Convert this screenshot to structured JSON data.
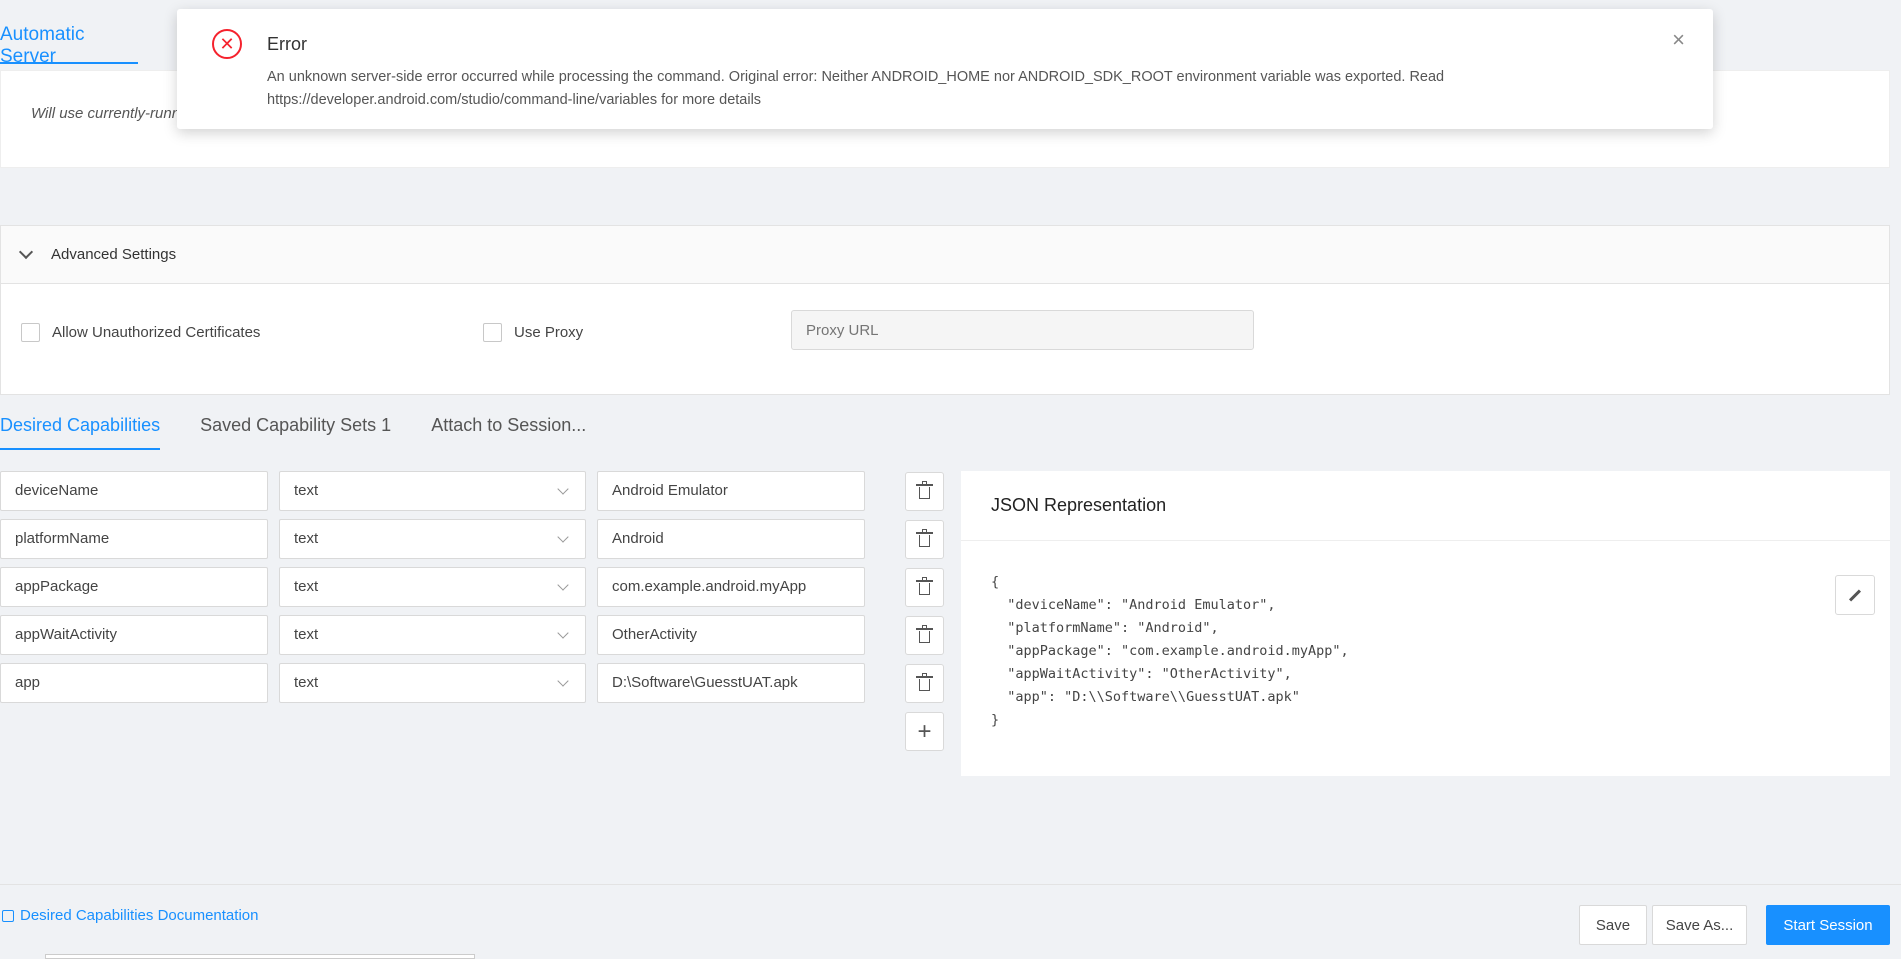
{
  "server": {
    "tab_label": "Automatic Server",
    "note": "Will use currently-running"
  },
  "advanced": {
    "title": "Advanced Settings",
    "allow_unauthorized": "Allow Unauthorized Certificates",
    "use_proxy": "Use Proxy",
    "proxy_placeholder": "Proxy URL"
  },
  "tabs": [
    {
      "label": "Desired Capabilities"
    },
    {
      "label": "Saved Capability Sets 1"
    },
    {
      "label": "Attach to Session..."
    }
  ],
  "capabilities": [
    {
      "name": "deviceName",
      "type": "text",
      "value": "Android Emulator"
    },
    {
      "name": "platformName",
      "type": "text",
      "value": "Android"
    },
    {
      "name": "appPackage",
      "type": "text",
      "value": "com.example.android.myApp"
    },
    {
      "name": "appWaitActivity",
      "type": "text",
      "value": "OtherActivity"
    },
    {
      "name": "app",
      "type": "text",
      "value": "D:\\Software\\GuesstUAT.apk"
    }
  ],
  "json_panel": {
    "title": "JSON Representation",
    "code": "{\n  \"deviceName\": \"Android Emulator\",\n  \"platformName\": \"Android\",\n  \"appPackage\": \"com.example.android.myApp\",\n  \"appWaitActivity\": \"OtherActivity\",\n  \"app\": \"D:\\\\Software\\\\GuesstUAT.apk\"\n}"
  },
  "footer": {
    "doc_link": "Desired Capabilities Documentation",
    "save": "Save",
    "save_as": "Save As...",
    "start": "Start Session"
  },
  "notification": {
    "title": "Error",
    "message": "An unknown server-side error occurred while processing the command. Original error: Neither ANDROID_HOME nor ANDROID_SDK_ROOT environment variable was exported. Read https://developer.android.com/studio/command-line/variables for more details"
  },
  "colors": {
    "accent": "#1890ff",
    "error": "#f5222d"
  }
}
